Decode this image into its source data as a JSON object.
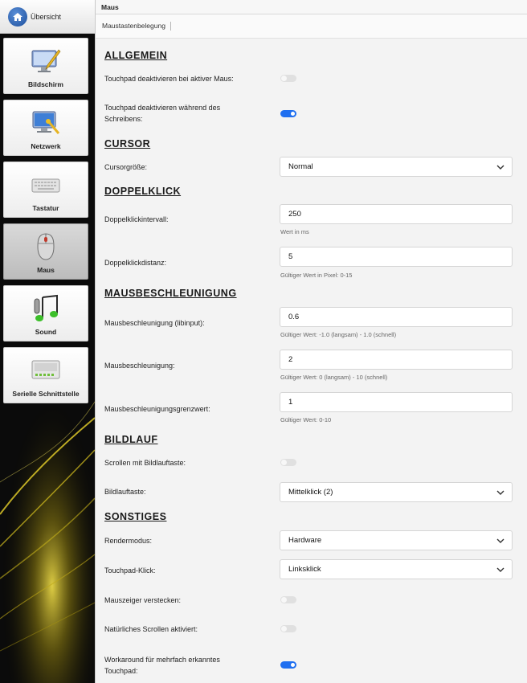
{
  "sidebar": {
    "home_label": "Übersicht",
    "items": [
      {
        "label": "Bildschirm",
        "icon": "monitor-pen-icon",
        "active": false
      },
      {
        "label": "Netzwerk",
        "icon": "network-monitor-icon",
        "active": false
      },
      {
        "label": "Tastatur",
        "icon": "keyboard-icon",
        "active": false
      },
      {
        "label": "Maus",
        "icon": "mouse-icon",
        "active": true
      },
      {
        "label": "Sound",
        "icon": "music-note-icon",
        "active": false
      },
      {
        "label": "Serielle Schnittstelle",
        "icon": "serial-port-icon",
        "active": false
      }
    ]
  },
  "window": {
    "title": "Maus"
  },
  "tabs": [
    {
      "label": "Maustastenbelegung"
    }
  ],
  "sections": {
    "allgemein": {
      "title": "ALLGEMEIN",
      "touchpad_mouse_label": "Touchpad deaktivieren bei aktiver Maus:",
      "touchpad_mouse_on": false,
      "touchpad_typing_label_1": "Touchpad deaktivieren während des",
      "touchpad_typing_label_2": "Schreibens:",
      "touchpad_typing_on": true
    },
    "cursor": {
      "title": "CURSOR",
      "size_label": "Cursorgröße:",
      "size_value": "Normal"
    },
    "doppelklick": {
      "title": "DOPPELKLICK",
      "interval_label": "Doppelklickintervall:",
      "interval_value": "250",
      "interval_hint": "Wert in ms",
      "distance_label": "Doppelklickdistanz:",
      "distance_value": "5",
      "distance_hint": "Gültiger Wert in Pixel: 0-15"
    },
    "beschleunigung": {
      "title": "MAUSBESCHLEUNIGUNG",
      "libinput_label": "Mausbeschleunigung (libinput):",
      "libinput_value": "0.6",
      "libinput_hint": "Gültiger Wert: -1.0 (langsam) - 1.0 (schnell)",
      "accel_label": "Mausbeschleunigung:",
      "accel_value": "2",
      "accel_hint": "Gültiger Wert: 0 (langsam) - 10 (schnell)",
      "threshold_label": "Mausbeschleunigungsgrenzwert:",
      "threshold_value": "1",
      "threshold_hint": "Gültiger Wert: 0-10"
    },
    "bildlauf": {
      "title": "BILDLAUF",
      "scroll_label": "Scrollen mit Bildlauftaste:",
      "scroll_on": false,
      "key_label": "Bildlauftaste:",
      "key_value": "Mittelklick (2)"
    },
    "sonstiges": {
      "title": "SONSTIGES",
      "render_label": "Rendermodus:",
      "render_value": "Hardware",
      "click_label": "Touchpad-Klick:",
      "click_value": "Linksklick",
      "hide_label": "Mauszeiger verstecken:",
      "hide_on": false,
      "natural_label": "Natürliches Scrollen aktiviert:",
      "natural_on": false,
      "workaround_label_1": "Workaround für mehrfach erkanntes",
      "workaround_label_2": "Touchpad:",
      "workaround_on": true
    }
  },
  "colors": {
    "accent": "#1f6ff0",
    "sidebar_bg": "#0a0a0a",
    "wave": "#d4b800"
  }
}
